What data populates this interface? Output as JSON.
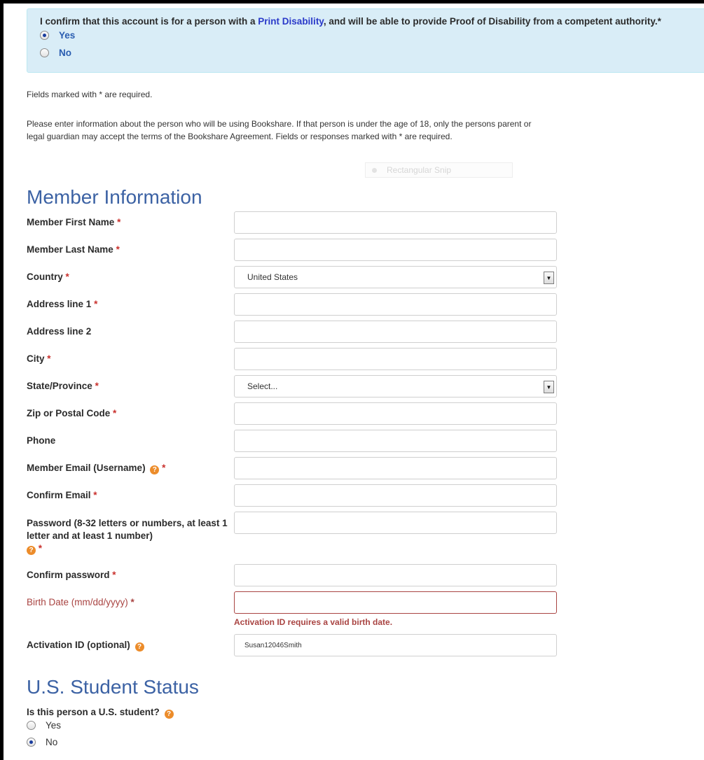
{
  "disability": {
    "statement_before": "I confirm that this account is for a person with a ",
    "link_text": "Print Disability",
    "statement_after": ", and will be able to provide Proof of Disability from a competent authority.",
    "required_mark": "*",
    "options": [
      {
        "label": "Yes",
        "selected": true
      },
      {
        "label": "No",
        "selected": false
      }
    ]
  },
  "notes": {
    "required_note": "Fields marked with * are required.",
    "info": "Please enter information about the person who will be using Bookshare. If that person is under the age of 18, only the persons parent or legal guardian may accept the terms of the Bookshare Agreement. Fields or responses marked with * are required."
  },
  "overlay": {
    "snip_label": "Rectangular Snip"
  },
  "member": {
    "section_title": "Member Information",
    "required_mark": "*",
    "help_glyph": "?",
    "fields": {
      "first_name": {
        "label": "Member First Name",
        "value": ""
      },
      "last_name": {
        "label": "Member Last Name",
        "value": ""
      },
      "country": {
        "label": "Country",
        "selected": "United States"
      },
      "address1": {
        "label": "Address line 1",
        "value": ""
      },
      "address2": {
        "label": "Address line 2",
        "value": ""
      },
      "city": {
        "label": "City",
        "value": ""
      },
      "state": {
        "label": "State/Province",
        "selected": "Select..."
      },
      "zip": {
        "label": "Zip or Postal Code",
        "value": ""
      },
      "phone": {
        "label": "Phone",
        "value": ""
      },
      "email": {
        "label": "Member Email (Username)",
        "value": ""
      },
      "confirm_email": {
        "label": "Confirm Email",
        "value": ""
      },
      "password": {
        "label": "Password (8-32 letters or numbers, at least 1 letter and at least 1 number)",
        "value": ""
      },
      "confirm_password": {
        "label": "Confirm password",
        "value": ""
      },
      "birth_date": {
        "label": "Birth Date (mm/dd/yyyy)",
        "value": "",
        "error": "Activation ID requires a valid birth date."
      },
      "activation_id": {
        "label": "Activation ID (optional)",
        "value": "Susan12046Smith"
      }
    }
  },
  "student": {
    "section_title": "U.S. Student Status",
    "question": "Is this person a U.S. student?",
    "options": [
      {
        "label": "Yes",
        "selected": false
      },
      {
        "label": "No",
        "selected": true
      }
    ]
  },
  "colors": {
    "info_box_bg": "#d9edf7",
    "section_title": "#3c62a4",
    "required": "#c9302c",
    "error": "#a94442",
    "help_icon": "#ec8c2a",
    "link": "#2a39c9"
  }
}
